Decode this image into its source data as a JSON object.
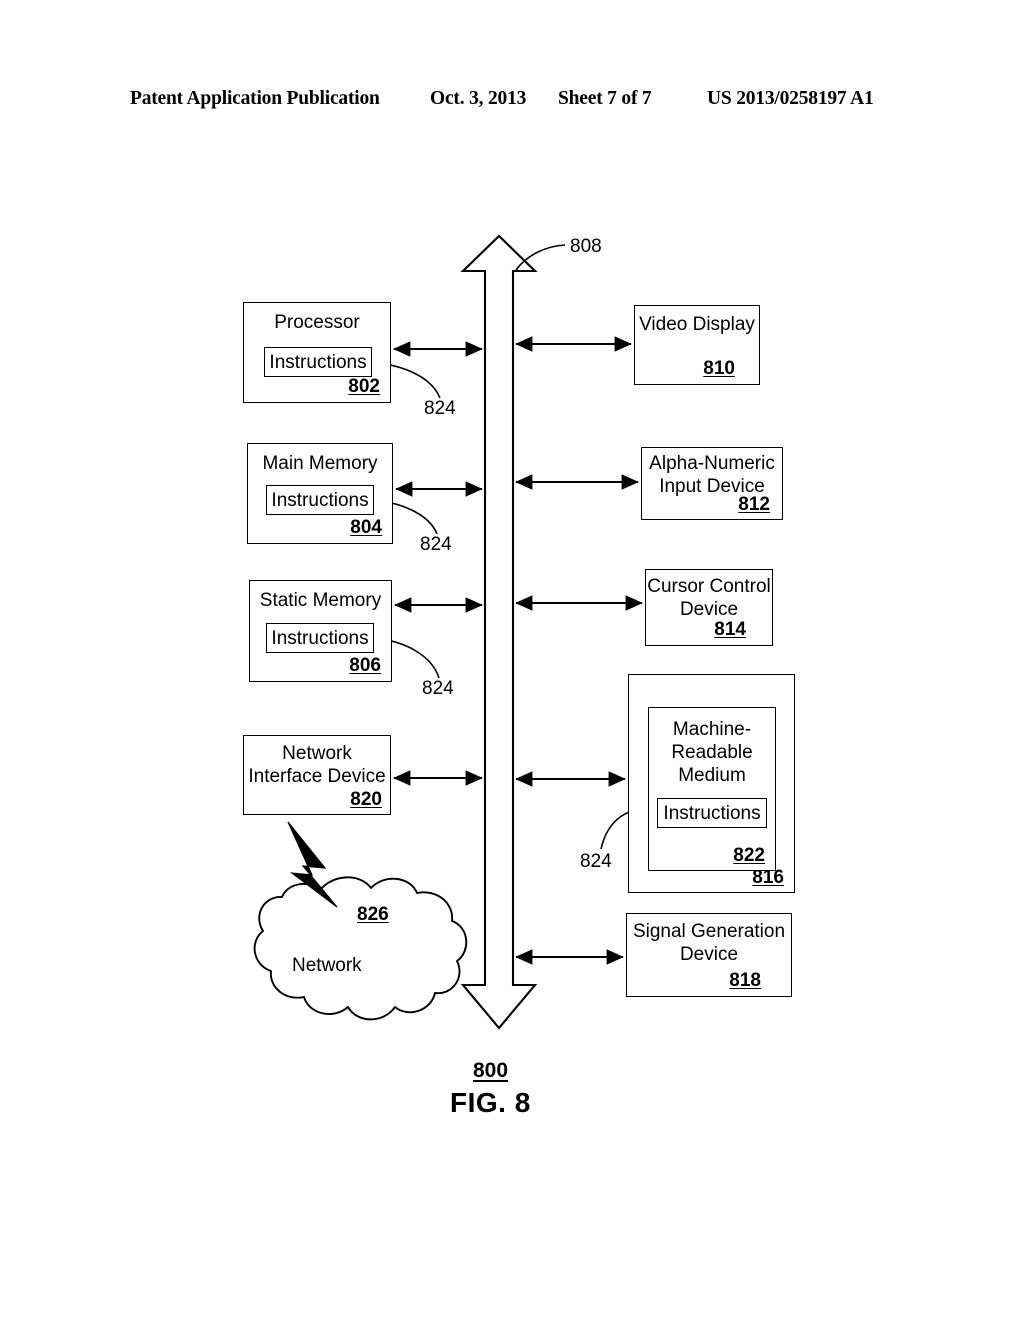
{
  "header": {
    "publication": "Patent Application Publication",
    "date": "Oct. 3, 2013",
    "sheet": "Sheet 7 of 7",
    "patent_number": "US 2013/0258197 A1"
  },
  "figure": {
    "caption": "FIG. 8",
    "system_ref": "800",
    "bus_ref": "808",
    "left_column": [
      {
        "title": "Processor",
        "ref": "802",
        "inner": {
          "label": "Instructions",
          "ref": "824"
        }
      },
      {
        "title": "Main Memory",
        "ref": "804",
        "inner": {
          "label": "Instructions",
          "ref": "824"
        }
      },
      {
        "title": "Static Memory",
        "ref": "806",
        "inner": {
          "label": "Instructions",
          "ref": "824"
        }
      },
      {
        "title": "Network\nInterface\nDevice",
        "ref": "820"
      }
    ],
    "right_column": [
      {
        "title": "Video\nDisplay",
        "ref": "810"
      },
      {
        "title": "Alpha-Numeric\nInput\nDevice",
        "ref": "812"
      },
      {
        "title": "Cursor Control\nDevice",
        "ref": "814"
      },
      {
        "title": "Machine-\nReadable\nMedium",
        "ref": "822",
        "outer_ref": "816",
        "inner": {
          "label": "Instructions",
          "ref": "824"
        }
      },
      {
        "title": "Signal Generation\nDevice",
        "ref": "818"
      }
    ],
    "network": {
      "label": "Network",
      "ref": "826"
    },
    "connector_refs": {
      "instruction_leader": "824"
    }
  },
  "colors": {
    "ink": "#000000",
    "paper": "#ffffff"
  }
}
